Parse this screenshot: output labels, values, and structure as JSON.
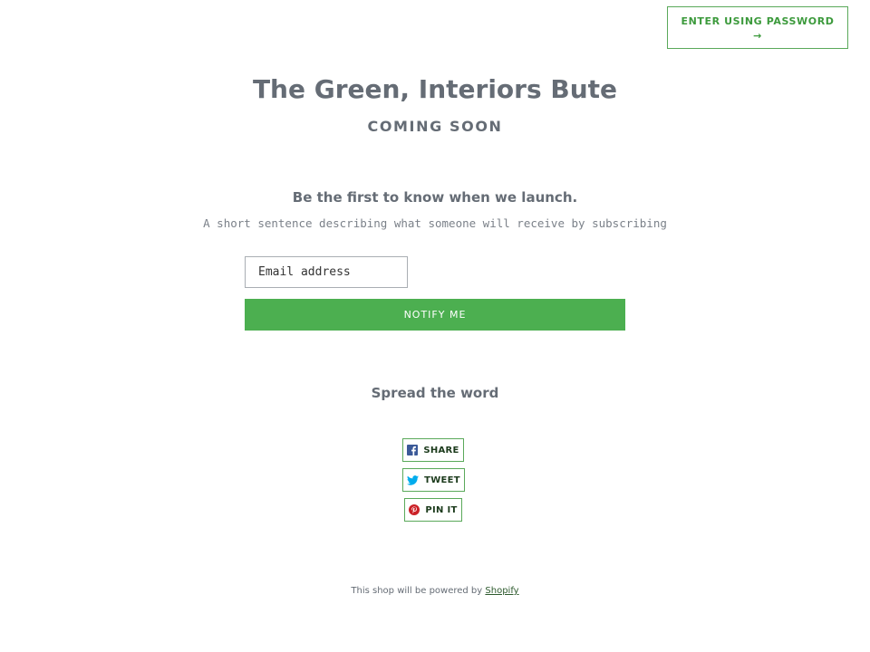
{
  "header": {
    "password_button_label": "ENTER USING PASSWORD",
    "password_button_arrow": "→"
  },
  "hero": {
    "title": "The Green, Interiors Bute",
    "subtitle": "COMING SOON"
  },
  "signup": {
    "heading": "Be the first to know when we launch.",
    "description": "A short sentence describing what someone will receive by subscribing",
    "email_placeholder": "Email address",
    "submit_label": "NOTIFY ME"
  },
  "social": {
    "heading": "Spread the word",
    "buttons": [
      {
        "label": "SHARE",
        "icon": "facebook-icon",
        "color": "#3b5998"
      },
      {
        "label": "TWEET",
        "icon": "twitter-icon",
        "color": "#00aced"
      },
      {
        "label": "PIN IT",
        "icon": "pinterest-icon",
        "color": "#cb2027"
      }
    ]
  },
  "footer": {
    "text": "This shop will be powered by",
    "link_label": "Shopify"
  },
  "colors": {
    "accent": "#4caf50",
    "text": "#656c75",
    "border": "#5aa95a"
  }
}
